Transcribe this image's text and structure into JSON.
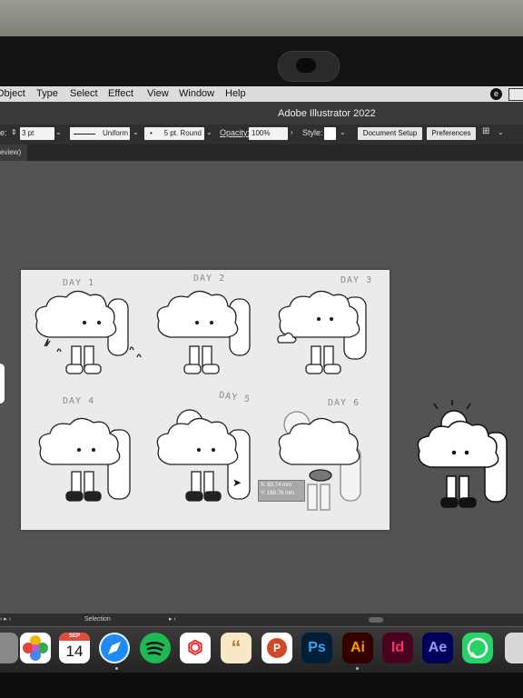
{
  "menubar": {
    "items": [
      "Object",
      "Type",
      "Select",
      "Effect",
      "View",
      "Window",
      "Help"
    ]
  },
  "window": {
    "title": "Adobe Illustrator 2022"
  },
  "controlbar": {
    "stroke_label": "e:",
    "stroke_value": "3 pt",
    "profile": "Uniform",
    "brush": "5 pt. Round",
    "opacity_label": "Opacity:",
    "opacity_value": "100%",
    "style_label": "Style:",
    "document_setup": "Document Setup",
    "preferences": "Preferences"
  },
  "tab": {
    "label": "eview)"
  },
  "artboard": {
    "day_labels": [
      "DAY 1",
      "DAY 2",
      "DAY 3",
      "DAY 4",
      "DAY 5",
      "DAY 6"
    ]
  },
  "readout": {
    "x": "X: 83.74 mm",
    "y": "Y: 169.76 mm"
  },
  "statusbar": {
    "tool": "Selection"
  },
  "dock": {
    "calendar_month": "SEP",
    "calendar_day": "14",
    "ps": "Ps",
    "ai": "Ai",
    "id": "Id",
    "ae": "Ae",
    "quote": "“",
    "pdf": "⏣",
    "p": "P"
  }
}
